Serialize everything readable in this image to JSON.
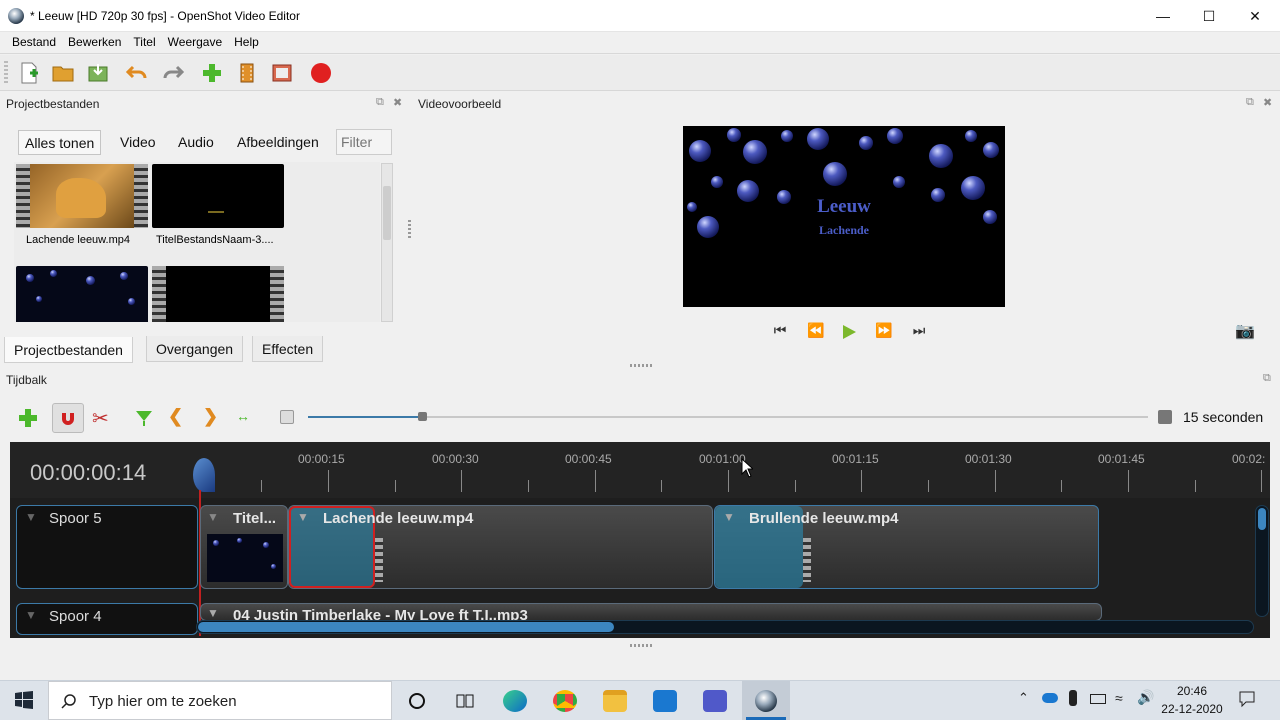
{
  "window": {
    "title": "* Leeuw [HD 720p 30 fps] - OpenShot Video Editor",
    "icon": "openshot-icon"
  },
  "menu": [
    "Bestand",
    "Bewerken",
    "Titel",
    "Weergave",
    "Help"
  ],
  "toolbar_icons": [
    "new-project-icon",
    "open-project-icon",
    "save-project-icon",
    "undo-icon",
    "redo-icon",
    "import-files-icon",
    "choose-profile-icon",
    "fullscreen-icon",
    "export-video-icon"
  ],
  "project_panel": {
    "title": "Projectbestanden",
    "filters": [
      "Alles tonen",
      "Video",
      "Audio",
      "Afbeeldingen"
    ],
    "filter_placeholder": "Filter",
    "files": [
      {
        "name": "Lachende leeuw.mp4"
      },
      {
        "name": "TitelBestandsNaam-3...."
      },
      {
        "name": ""
      },
      {
        "name": ""
      }
    ],
    "tabs": [
      "Projectbestanden",
      "Overgangen",
      "Effecten"
    ]
  },
  "preview_panel": {
    "title": "Videovoorbeeld",
    "frame_title": "Leeuw",
    "frame_subtitle": "Lachende"
  },
  "timeline": {
    "title": "Tijdbalk",
    "current_time": "00:00:00:14",
    "zoom_label": "15 seconden",
    "ruler": [
      "00:00:15",
      "00:00:30",
      "00:00:45",
      "00:01:00",
      "00:01:15",
      "00:01:30",
      "00:01:45",
      "00:02:"
    ],
    "tracks": [
      {
        "name": "Spoor 5",
        "clips": [
          "Titel...",
          "Lachende leeuw.mp4",
          "Brullende leeuw.mp4"
        ]
      },
      {
        "name": "Spoor 4",
        "clips": [
          "04 Justin Timberlake - My Love ft T.I..mp3"
        ]
      }
    ]
  },
  "taskbar": {
    "search_placeholder": "Typ hier om te zoeken",
    "time": "20:46",
    "date": "22-12-2020"
  },
  "colors": {
    "accent": "#3c7aa8",
    "playhead": "#c02020",
    "clip_select": "#d02020"
  }
}
